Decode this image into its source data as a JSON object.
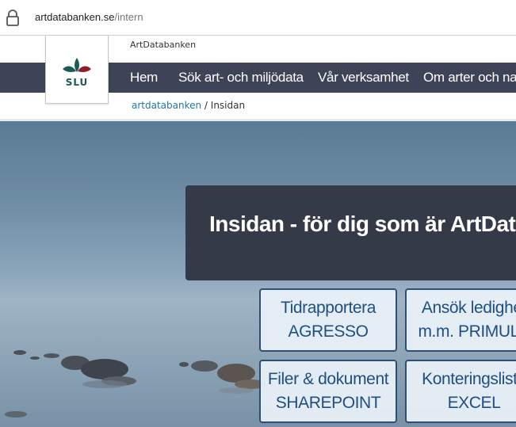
{
  "browser": {
    "url_host": "artdatabanken.se",
    "url_path": "/intern"
  },
  "site": {
    "name": "ArtDatabanken",
    "logo_text": "SLU",
    "nav": [
      "Hem",
      "Sök art- och miljödata",
      "Vår verksamhet",
      "Om arter och natur"
    ],
    "breadcrumb": {
      "link": "artdatabanken",
      "separator": " / ",
      "current": "Insidan"
    }
  },
  "hero": {
    "title": "Insidan - för dig som är ArtDatabanken-anställd",
    "tiles": [
      {
        "line1": "Tidrapportera",
        "line2": "AGRESSO"
      },
      {
        "line1": "Ansök ledighet",
        "line2": "m.m. PRIMULA"
      },
      {
        "line1": "Filer & dokument",
        "line2": "SHAREPOINT"
      },
      {
        "line1": "Konteringslista",
        "line2": "EXCEL"
      }
    ]
  },
  "colors": {
    "navbar": "#3d4458",
    "title_box": "#343a47",
    "tile_border": "#2e4f73",
    "tile_text": "#1f4f80",
    "breadcrumb_link": "#23769c",
    "logo_green": "#1b5a55",
    "logo_red": "#8b1d2c"
  }
}
